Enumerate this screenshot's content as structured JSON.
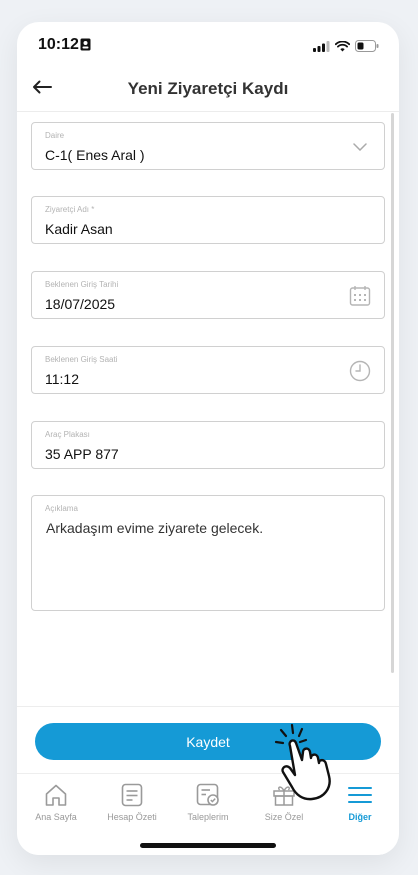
{
  "status_bar": {
    "time": "10:12"
  },
  "header": {
    "title": "Yeni Ziyaretçi Kaydı"
  },
  "form": {
    "daire": {
      "label": "Daire",
      "value": "C-1( Enes Aral )"
    },
    "ziyaretci_adi": {
      "label": "Ziyaretçi Adı *",
      "value": "Kadir Asan"
    },
    "giris_tarihi": {
      "label": "Beklenen Giriş Tarihi",
      "value": "18/07/2025"
    },
    "giris_saati": {
      "label": "Beklenen Giriş Saati",
      "value": "11:12"
    },
    "arac_plakasi": {
      "label": "Araç Plakası",
      "value": "35 APP 877"
    },
    "aciklama": {
      "label": "Açıklama",
      "value": "Arkadaşım evime ziyarete gelecek."
    }
  },
  "save_button": {
    "label": "Kaydet"
  },
  "tabbar": {
    "items": [
      {
        "label": "Ana Sayfa",
        "icon": "home-icon"
      },
      {
        "label": "Hesap Özeti",
        "icon": "document-list-icon"
      },
      {
        "label": "Taleplerim",
        "icon": "request-check-icon"
      },
      {
        "label": "Size Özel",
        "icon": "gift-icon"
      },
      {
        "label": "Diğer",
        "icon": "menu-icon",
        "active": true
      }
    ]
  },
  "colors": {
    "accent": "#159ad6",
    "border": "#d0d0d0",
    "label": "#b3b3b3"
  }
}
